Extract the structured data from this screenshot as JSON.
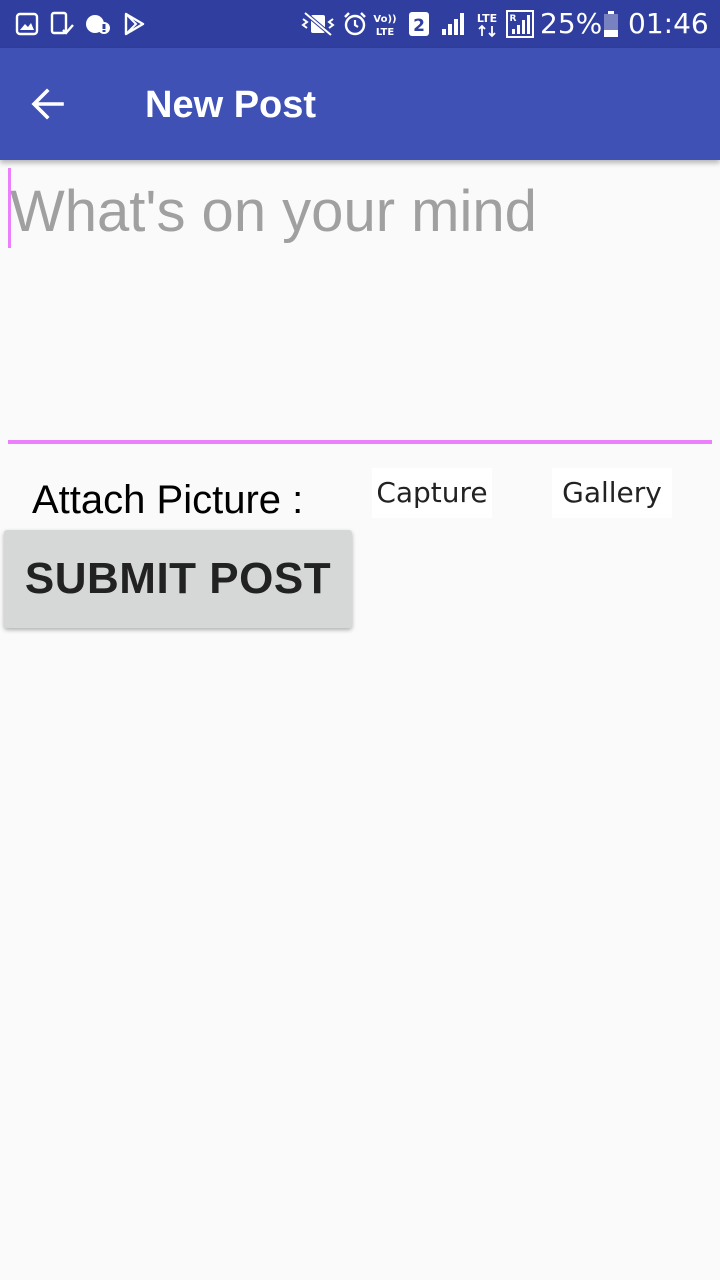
{
  "status_bar": {
    "battery_percent": "25%",
    "time": "01:46",
    "sim_slot": "2",
    "network_lte": "LTE",
    "volte": "Vo)) LTE",
    "background": "#303f9f"
  },
  "app_bar": {
    "title": "New Post",
    "back_icon": "arrow-left-icon",
    "background": "#3f51b5"
  },
  "post_input": {
    "placeholder": "What's on your mind",
    "value": "",
    "accent_color": "#ea80fc"
  },
  "attach": {
    "label": "Attach Picture :",
    "capture_label": "Capture",
    "gallery_label": "Gallery"
  },
  "submit": {
    "label": "SUBMIT POST"
  }
}
